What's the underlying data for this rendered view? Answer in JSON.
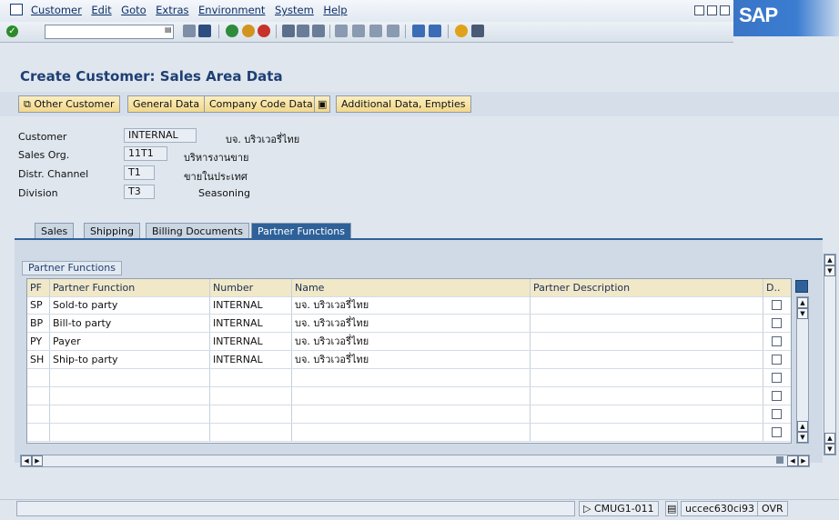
{
  "menubar": {
    "items": [
      "Customer",
      "Edit",
      "Goto",
      "Extras",
      "Environment",
      "System",
      "Help"
    ]
  },
  "logo": "SAP",
  "page": {
    "title": "Create Customer: Sales Area Data"
  },
  "app_toolbar": {
    "other_customer": "Other Customer",
    "general_data": "General Data",
    "company_code_data": "Company Code Data",
    "additional_data": "Additional Data, Empties"
  },
  "header": {
    "customer_label": "Customer",
    "customer_value": "INTERNAL",
    "customer_desc": "บจ. บริวเวอรี่ไทย",
    "sales_org_label": "Sales Org.",
    "sales_org_value": "11T1",
    "sales_org_desc": "บริหารงานขาย",
    "distr_channel_label": "Distr. Channel",
    "distr_channel_value": "T1",
    "distr_channel_desc": "ขายในประเทศ",
    "division_label": "Division",
    "division_value": "T3",
    "division_desc": "Seasoning"
  },
  "tabs": [
    {
      "label": "Sales",
      "active": false
    },
    {
      "label": "Shipping",
      "active": false
    },
    {
      "label": "Billing Documents",
      "active": false
    },
    {
      "label": "Partner Functions",
      "active": true
    }
  ],
  "partner_table": {
    "frame_title": "Partner Functions",
    "columns": [
      "PF",
      "Partner Function",
      "Number",
      "Name",
      "Partner Description",
      "D.."
    ],
    "rows": [
      {
        "pf": "SP",
        "function": "Sold-to party",
        "number": "INTERNAL",
        "name": "บจ. บริวเวอรี่ไทย",
        "description": ""
      },
      {
        "pf": "BP",
        "function": "Bill-to party",
        "number": "INTERNAL",
        "name": "บจ. บริวเวอรี่ไทย",
        "description": ""
      },
      {
        "pf": "PY",
        "function": "Payer",
        "number": "INTERNAL",
        "name": "บจ. บริวเวอรี่ไทย",
        "description": ""
      },
      {
        "pf": "SH",
        "function": "Ship-to party",
        "number": "INTERNAL",
        "name": "บจ. บริวเวอรี่ไทย",
        "description": ""
      }
    ]
  },
  "status_bar": {
    "system": "CMUG1-011",
    "server": "uccec630ci93",
    "mode": "OVR"
  }
}
